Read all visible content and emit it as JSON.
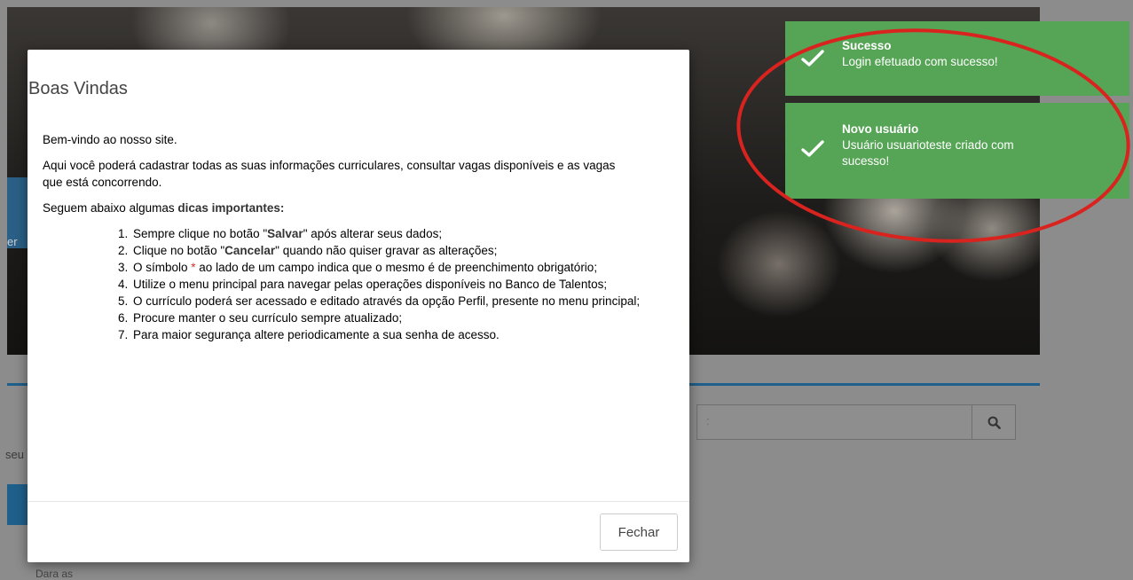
{
  "background": {
    "side_text_top": "er",
    "side_text_mid": "seu",
    "side_text_bottom": "Dara as",
    "search_placeholder": ":"
  },
  "modal": {
    "title": "Boas Vindas",
    "welcome": "Bem-vindo ao nosso site.",
    "intro": "Aqui você poderá cadastrar todas as suas informações curriculares, consultar vagas disponíveis e as vagas que está concorrendo.",
    "tips_prefix": "Seguem abaixo algumas ",
    "tips_bold": "dicas importantes:",
    "tips": [
      {
        "before": "Sempre clique no botão \"",
        "bold": "Salvar",
        "after": "\" após alterar seus dados;"
      },
      {
        "before": "Clique no botão \"",
        "bold": "Cancelar",
        "after": "\" quando não quiser gravar as alterações;"
      },
      {
        "before": "O símbolo ",
        "star": "*",
        "after": " ao lado de um campo indica que o mesmo é de preenchimento obrigatório;"
      },
      {
        "text": "Utilize o menu principal para navegar pelas operações disponíveis no Banco de Talentos;"
      },
      {
        "text": "O currículo poderá ser acessado e editado através da opção Perfil, presente no menu principal;"
      },
      {
        "text": "Procure manter o seu currículo sempre atualizado;"
      },
      {
        "text": "Para maior segurança altere periodicamente a sua senha de acesso."
      }
    ],
    "close_label": "Fechar"
  },
  "toasts": [
    {
      "title": "Sucesso",
      "message": "Login efetuado com sucesso!"
    },
    {
      "title": "Novo usuário",
      "message": "Usuário usuarioteste criado com sucesso!"
    }
  ],
  "colors": {
    "toast_green": "#56a455",
    "annotation_red": "#d9231f",
    "brand_blue": "#1f5f8b"
  },
  "icons": {
    "toast": "check-icon",
    "search": "search-icon"
  }
}
